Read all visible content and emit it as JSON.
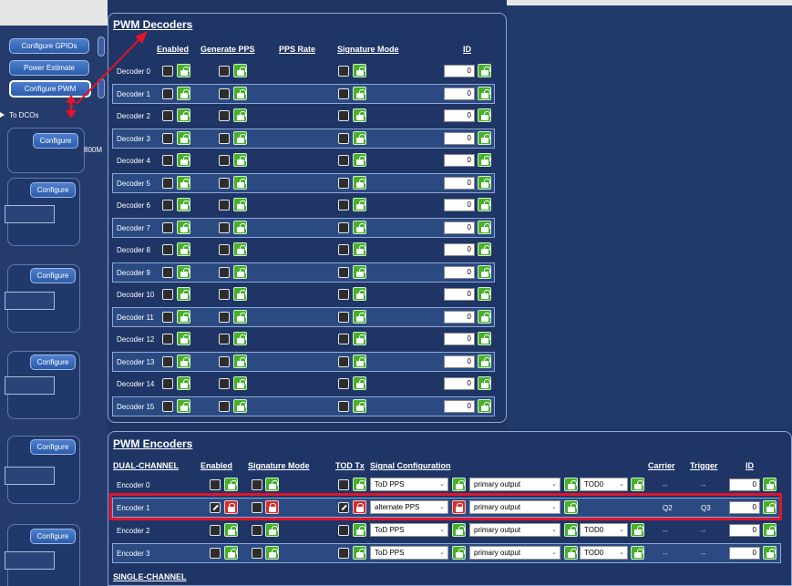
{
  "left": {
    "buttons": {
      "configure_gpios": "Configure GPIOs",
      "power_estimate": "Power Estimate",
      "configure_pwm": "Configure PWM"
    },
    "to_dcos": "To DCOs",
    "configure": "Configure",
    "side_text": "800M"
  },
  "decoders": {
    "title": "PWM Decoders",
    "headers": {
      "enabled": "Enabled",
      "generate_pps": "Generate PPS",
      "pps_rate": "PPS Rate",
      "signature_mode": "Signature Mode",
      "id": "ID"
    },
    "rows": [
      {
        "label": "Decoder 0",
        "id": "0"
      },
      {
        "label": "Decoder 1",
        "id": "0"
      },
      {
        "label": "Decoder 2",
        "id": "0"
      },
      {
        "label": "Decoder 3",
        "id": "0"
      },
      {
        "label": "Decoder 4",
        "id": "0"
      },
      {
        "label": "Decoder 5",
        "id": "0"
      },
      {
        "label": "Decoder 6",
        "id": "0"
      },
      {
        "label": "Decoder 7",
        "id": "0"
      },
      {
        "label": "Decoder 8",
        "id": "0"
      },
      {
        "label": "Decoder 9",
        "id": "0"
      },
      {
        "label": "Decoder 10",
        "id": "0"
      },
      {
        "label": "Decoder 11",
        "id": "0"
      },
      {
        "label": "Decoder 12",
        "id": "0"
      },
      {
        "label": "Decoder 13",
        "id": "0"
      },
      {
        "label": "Decoder 14",
        "id": "0"
      },
      {
        "label": "Decoder 15",
        "id": "0"
      }
    ]
  },
  "encoders": {
    "title": "PWM Encoders",
    "section_dual": "DUAL-CHANNEL",
    "section_single": "SINGLE-CHANNEL",
    "headers": {
      "enabled": "Enabled",
      "signature_mode": "Signature Mode",
      "tod_tx": "TOD Tx",
      "signal_configuration": "Signal Configuration",
      "carrier": "Carrier",
      "trigger": "Trigger",
      "id": "ID"
    },
    "rows": [
      {
        "label": "Encoder 0",
        "signal": "ToD PPS",
        "output": "primary output",
        "tod": "TOD0",
        "carrier": "--",
        "trigger": "--",
        "id": "0"
      },
      {
        "label": "Encoder 1",
        "signal": "alternate PPS",
        "output": "primary output",
        "tod": "",
        "carrier": "Q2",
        "trigger": "Q3",
        "id": "0"
      },
      {
        "label": "Encoder 2",
        "signal": "ToD PPS",
        "output": "primary output",
        "tod": "TOD0",
        "carrier": "--",
        "trigger": "--",
        "id": "0"
      },
      {
        "label": "Encoder 3",
        "signal": "ToD PPS",
        "output": "primary output",
        "tod": "TOD0",
        "carrier": "--",
        "trigger": "--",
        "id": "0"
      }
    ]
  },
  "colors": {
    "background": "#1f3563",
    "unlock_green": "#46b12a",
    "lock_red": "#d32f2f",
    "highlight_red": "#e0142a"
  }
}
